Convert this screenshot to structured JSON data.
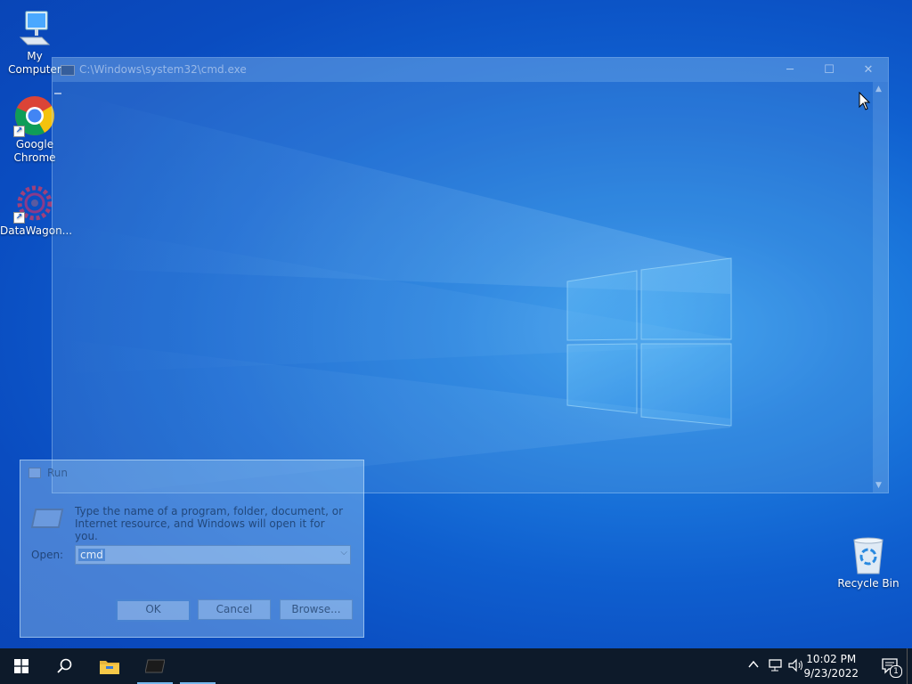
{
  "desktop": {
    "icons": [
      {
        "label": "My Computer",
        "icon": "computer-icon"
      },
      {
        "label": "Google\nChrome",
        "icon": "chrome-icon"
      },
      {
        "label": "DataWagon...",
        "icon": "gear-icon"
      },
      {
        "label": "Recycle Bin",
        "icon": "recycle-bin-icon"
      }
    ]
  },
  "cmd_window": {
    "title": "C:\\Windows\\system32\\cmd.exe",
    "minimize": "─",
    "maximize": "☐",
    "close": "✕"
  },
  "run_dialog": {
    "title": "Run",
    "description": "Type the name of a program, folder, document, or Internet resource, and Windows will open it for you.",
    "open_label": "Open:",
    "open_value": "cmd",
    "ok_label": "OK",
    "cancel_label": "Cancel",
    "browse_label": "Browse..."
  },
  "taskbar": {
    "time": "10:02 PM",
    "date": "9/23/2022",
    "notification_count": "1",
    "items": [
      "start-icon",
      "search-icon",
      "file-explorer-icon",
      "cmd-icon"
    ]
  },
  "colors": {
    "taskbar": "#0d1a2a",
    "accent": "#76b9ed"
  }
}
